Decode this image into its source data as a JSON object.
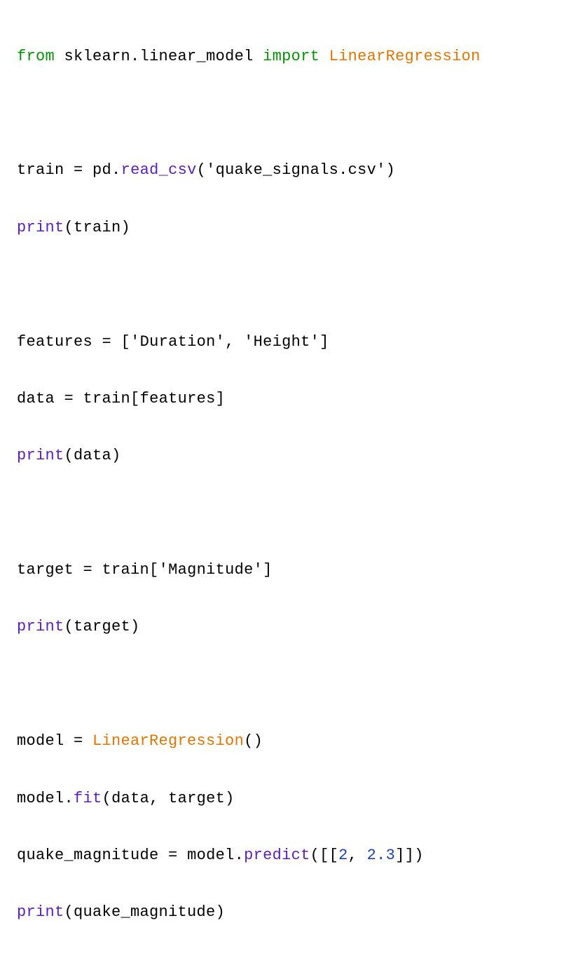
{
  "code": {
    "line1": {
      "from": "from",
      "module": "sklearn.linear_model",
      "import": "import",
      "class": "LinearRegression"
    },
    "line3": {
      "var": "train",
      "eq": " = ",
      "pd": "pd",
      "dot1": ".",
      "method": "read_csv",
      "open": "(",
      "arg": "'quake_signals.csv'",
      "close": ")"
    },
    "line4": {
      "fn": "print",
      "open": "(",
      "arg": "train",
      "close": ")"
    },
    "line6": {
      "var": "features",
      "eq": " = ",
      "open": "[",
      "s1": "'Duration'",
      "comma": ", ",
      "s2": "'Height'",
      "close": "]"
    },
    "line7": {
      "var": "data",
      "eq": " = ",
      "train": "train",
      "open": "[",
      "features": "features",
      "close": "]"
    },
    "line8": {
      "fn": "print",
      "open": "(",
      "arg": "data",
      "close": ")"
    },
    "line10": {
      "var": "target",
      "eq": " = ",
      "train": "train",
      "open": "[",
      "arg": "'Magnitude'",
      "close": "]"
    },
    "line11": {
      "fn": "print",
      "open": "(",
      "arg": "target",
      "close": ")"
    },
    "line13": {
      "var": "model",
      "eq": " = ",
      "class": "LinearRegression",
      "parens": "()"
    },
    "line14": {
      "obj": "model",
      "dot": ".",
      "method": "fit",
      "open": "(",
      "a1": "data",
      "comma": ", ",
      "a2": "target",
      "close": ")"
    },
    "line15": {
      "var": "quake_magnitude",
      "eq": " = ",
      "obj": "model",
      "dot": ".",
      "method": "predict",
      "open": "(",
      "ob1": "[[",
      "n1": "2",
      "comma": ", ",
      "n2": "2.3",
      "cb1": "]]",
      "close": ")"
    },
    "line16": {
      "fn": "print",
      "open": "(",
      "arg": "quake_magnitude",
      "close": ")"
    }
  }
}
